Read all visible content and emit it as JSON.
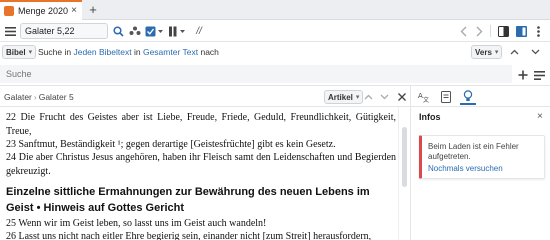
{
  "colors": {
    "accent": "#e8742a",
    "link": "#2b6cb0",
    "error": "#d94a4a"
  },
  "tab": {
    "title": "Menge 2020",
    "close": "×",
    "new_tab": "+"
  },
  "toolbar": {
    "reference_value": "Galater 5,22",
    "icons": [
      "hamburger-menu-icon",
      "search-icon",
      "people-icon",
      "checkbox-dropdown-icon",
      "columns-dropdown-icon",
      "parallel-slash-icon",
      "back-icon",
      "forward-icon",
      "split-view-icon",
      "sidebar-icon",
      "more-vert-icon"
    ],
    "slash_glyph": "//"
  },
  "search_scope": {
    "book_pill": "Bibel",
    "sentence_pre": "Suche in",
    "scope_link": "Jeden Bibeltext",
    "sentence_mid": "in",
    "target_link": "Gesamter Text",
    "sentence_post": "nach",
    "match_pill": "Vers"
  },
  "search": {
    "placeholder": "Suche"
  },
  "panel": {
    "breadcrumb": [
      "Galater",
      "Galater 5"
    ],
    "article_pill": "Artikel"
  },
  "text": {
    "v22_num": "22",
    "v22": "Die Frucht des Geistes aber ist Liebe, Freude, Friede, Geduld, Freundlichkeit, Gütigkeit, Treue,",
    "v23_num": "23",
    "v23": "Sanftmut, Beständigkeit ¹; gegen derartige [Geistesfrüchte] gibt es kein Gesetz.",
    "v24_num": "24",
    "v24": "Die aber Christus Jesus angehören, haben ihr Fleisch samt den Leidenschaften und Begierden gekreuzigt.",
    "heading": "Einzelne sittliche Ermahnungen zur Bewährung des neuen Lebens im Geist • Hinweis auf Gottes Gericht",
    "v25_num": "25",
    "v25": "Wenn wir im Geist leben, so lasst uns im Geist auch wandeln!",
    "v26_num": "26",
    "v26": "Lasst uns nicht nach eitler Ehre begierig sein, einander nicht [zum Streit] herausfordern,"
  },
  "info": {
    "title": "Infos",
    "close": "×",
    "message": "Beim Laden ist ein Fehler aufgetreten.",
    "retry": "Nochmals versuchen"
  }
}
